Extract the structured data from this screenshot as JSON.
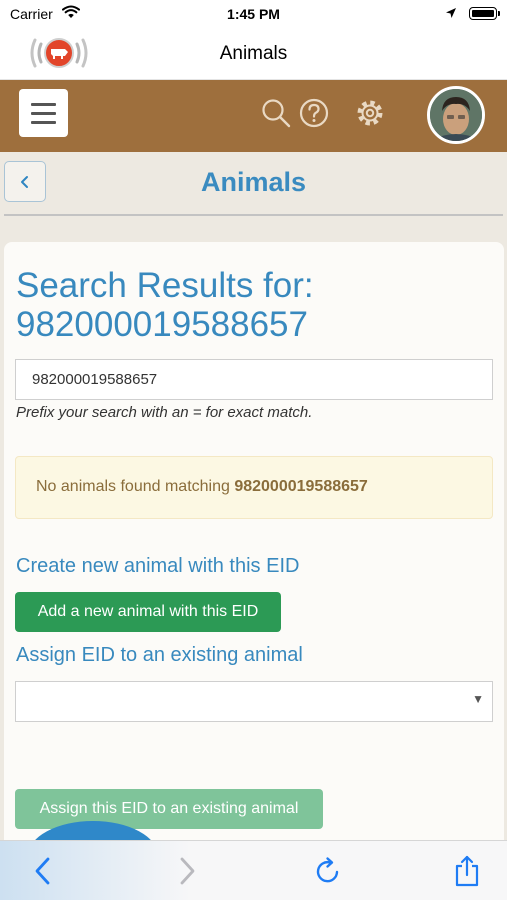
{
  "status_bar": {
    "carrier": "Carrier",
    "time": "1:45 PM"
  },
  "browser": {
    "title": "Animals"
  },
  "header": {
    "menu_icon": "hamburger-icon",
    "icons": [
      "search-icon",
      "help-icon",
      "gear-icon"
    ],
    "avatar": "user-avatar"
  },
  "page": {
    "title": "Animals",
    "back_icon": "chevron-left-icon"
  },
  "search": {
    "heading_prefix": "Search Results for:",
    "query": "982000019588657",
    "input_value": "982000019588657",
    "hint": "Prefix your search with an = for exact match."
  },
  "alert": {
    "text": "No animals found matching ",
    "query": "982000019588657"
  },
  "create": {
    "title": "Create new animal with this EID",
    "button": "Add a new animal with this EID"
  },
  "assign": {
    "title": "Assign EID to an existing animal",
    "select_value": "",
    "button": "Assign this EID to an existing animal"
  },
  "toolbar": {
    "icons": [
      "back-icon",
      "forward-icon",
      "reload-icon",
      "share-icon"
    ]
  },
  "colors": {
    "brand_brown": "#9e6f3d",
    "link_blue": "#3889be",
    "success_green": "#2c9a55",
    "warning_bg": "#fcf8e3",
    "warning_text": "#8a6d3b"
  }
}
